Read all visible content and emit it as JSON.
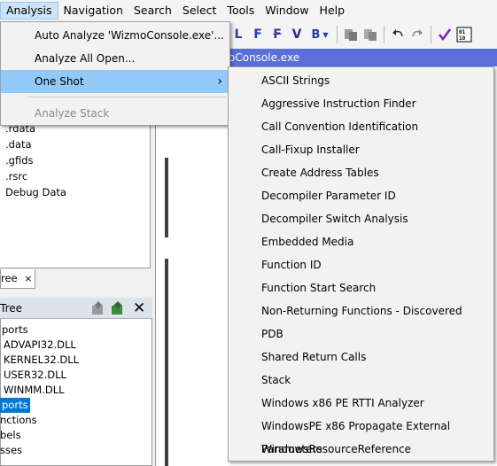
{
  "menubar": {
    "items": [
      "Analysis",
      "Navigation",
      "Search",
      "Select",
      "Tools",
      "Window",
      "Help"
    ]
  },
  "toolbar": {
    "icons": [
      "L",
      "F",
      "F",
      "V",
      "B"
    ]
  },
  "listing": {
    "title": "oConsole.exe"
  },
  "program_tree": {
    "items": [
      ".rdata",
      ".data",
      ".gfids",
      ".rsrc",
      "Debug Data"
    ],
    "tab_label": "ree"
  },
  "symbol_tree": {
    "header": "Tree",
    "items": [
      "ports",
      "ADVAPI32.DLL",
      "KERNEL32.DLL",
      "USER32.DLL",
      "WINMM.DLL",
      "ports",
      "nctions",
      "bels",
      "sses"
    ]
  },
  "analysis_menu": {
    "items": [
      {
        "label": "Auto Analyze 'WizmoConsole.exe'... A",
        "disabled": false
      },
      {
        "label": "Analyze All Open...",
        "disabled": false
      },
      {
        "label": "One Shot",
        "disabled": false,
        "submenu_arrow": "›"
      },
      {
        "label": "Analyze Stack",
        "disabled": true
      }
    ]
  },
  "one_shot_menu": {
    "items": [
      "ASCII Strings",
      "Aggressive Instruction Finder",
      "Call Convention Identification",
      "Call-Fixup Installer",
      "Create Address Tables",
      "Decompiler Parameter ID",
      "Decompiler Switch Analysis",
      "Embedded Media",
      "Function ID",
      "Function Start Search",
      "Non-Returning Functions - Discovered",
      "PDB",
      "Shared Return Calls",
      "Stack",
      "Windows x86 PE RTTI Analyzer",
      "WindowsPE x86 Propagate External Parameters",
      "WindowsResourceReference"
    ]
  },
  "colors": {
    "menu_highlight": "#91c9f7",
    "title_bar": "#5b6fd8",
    "selection": "#0078d7"
  }
}
